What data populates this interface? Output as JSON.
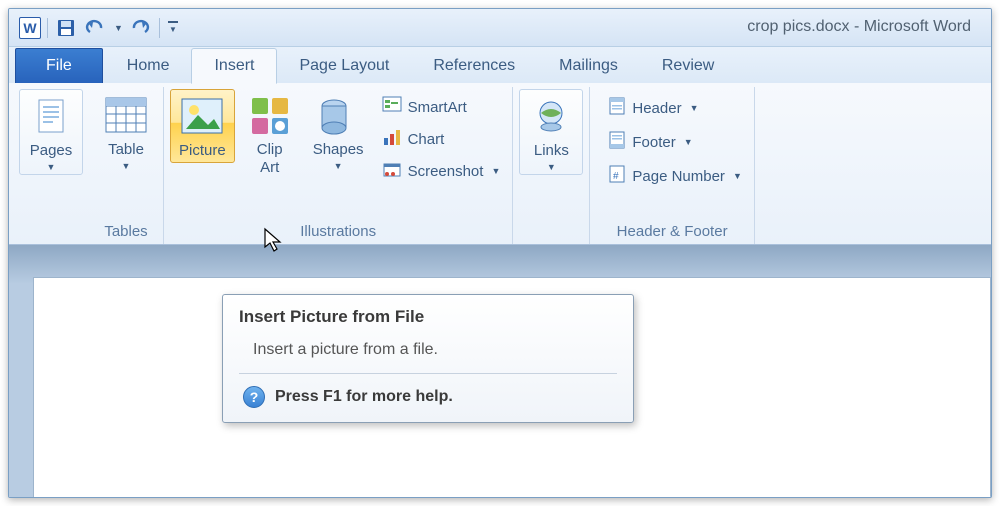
{
  "title": {
    "doc": "crop pics.docx",
    "sep": " - ",
    "app": "Microsoft Word"
  },
  "tabs": {
    "file": "File",
    "list": [
      "Home",
      "Insert",
      "Page Layout",
      "References",
      "Mailings",
      "Review"
    ],
    "active": "Insert"
  },
  "ribbon": {
    "pages": {
      "label": "Pages",
      "group": ""
    },
    "tables": {
      "group": "Tables",
      "table": "Table"
    },
    "illustrations": {
      "group": "Illustrations",
      "picture": "Picture",
      "clipart": "Clip Art",
      "shapes": "Shapes",
      "smartart": "SmartArt",
      "chart": "Chart",
      "screenshot": "Screenshot"
    },
    "links": {
      "label": "Links"
    },
    "hf": {
      "group": "Header & Footer",
      "header": "Header",
      "footer": "Footer",
      "pagenum": "Page Number"
    }
  },
  "tooltip": {
    "title": "Insert Picture from File",
    "body": "Insert a picture from a file.",
    "help": "Press F1 for more help."
  }
}
